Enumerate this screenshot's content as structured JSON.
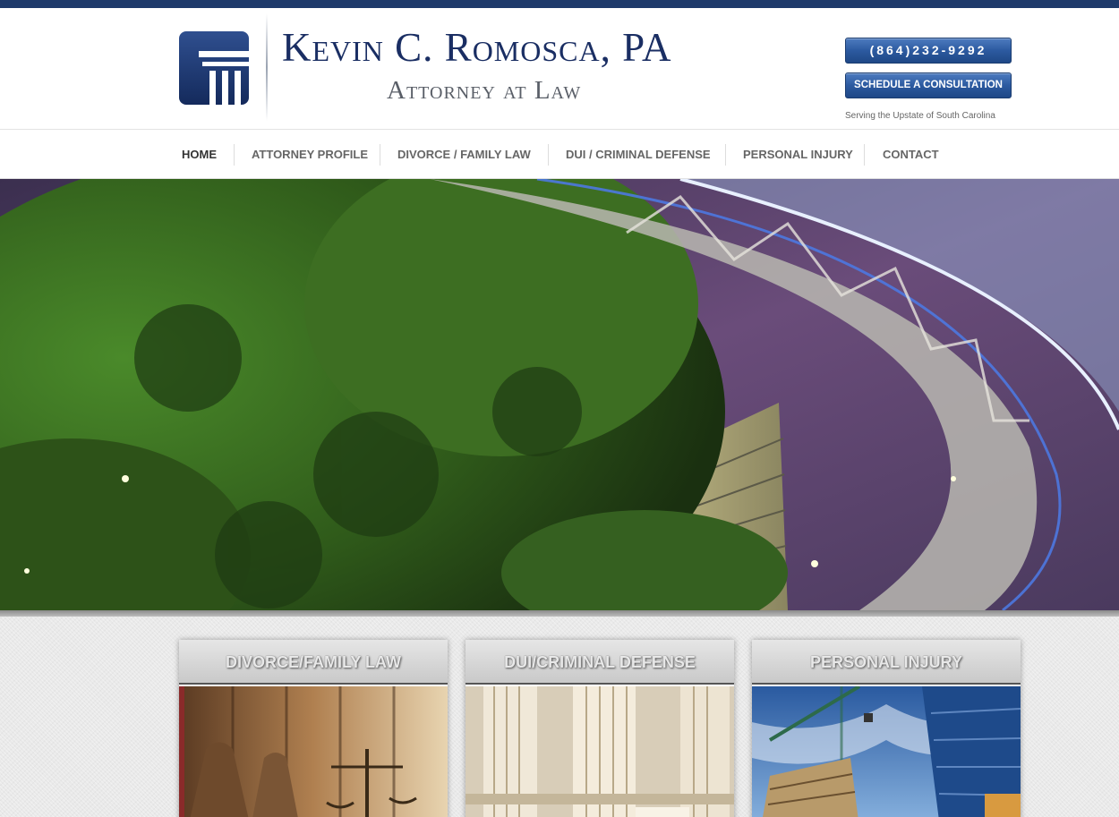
{
  "header": {
    "firm_name": "Kevin C. Romosca, PA",
    "tagline": "Attorney at Law",
    "phone_button": "(864)232-9292",
    "consult_button": "SCHEDULE A CONSULTATION",
    "serving_text": "Serving the Upstate of South Carolina"
  },
  "nav": {
    "items": [
      {
        "label": "HOME"
      },
      {
        "label": "ATTORNEY PROFILE"
      },
      {
        "label": "DIVORCE / FAMILY LAW"
      },
      {
        "label": "DUI / CRIMINAL DEFENSE"
      },
      {
        "label": "PERSONAL INJURY"
      },
      {
        "label": "CONTACT"
      }
    ]
  },
  "cards": [
    {
      "title": "DIVORCE/FAMILY LAW"
    },
    {
      "title": "DUI/CRIMINAL DEFENSE"
    },
    {
      "title": "PERSONAL INJURY"
    }
  ],
  "colors": {
    "brand_navy": "#1a2e63",
    "button_blue": "#2c5aa0",
    "top_bar": "#1e3a6b"
  }
}
